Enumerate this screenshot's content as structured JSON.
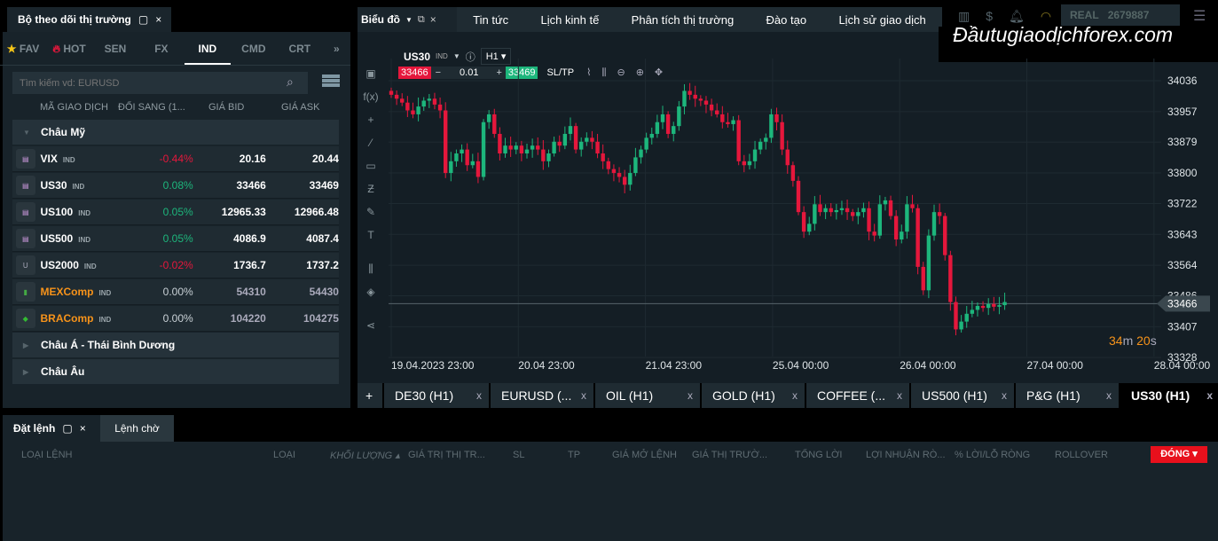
{
  "watchlist": {
    "title": "Bộ theo dõi thị trường",
    "tabs": [
      "FAV",
      "HOT",
      "SEN",
      "FX",
      "IND",
      "CMD",
      "CRT"
    ],
    "active_tab": "IND",
    "search_placeholder": "Tìm kiếm vd: EURUSD",
    "columns": [
      "MÃ GIAO DỊCH",
      "ĐỔI SANG (1...",
      "GIÁ BID",
      "GIÁ ASK"
    ],
    "groups": [
      "Châu Mỹ",
      "Châu Á - Thái Bình Dương",
      "Châu Âu"
    ],
    "rows": [
      {
        "symbol": "VIX",
        "type": "IND",
        "change": "-0.44%",
        "bid": "20.16",
        "ask": "20.44",
        "dir": "down",
        "flag": "us"
      },
      {
        "symbol": "US30",
        "type": "IND",
        "change": "0.08%",
        "bid": "33466",
        "ask": "33469",
        "dir": "up",
        "flag": "us"
      },
      {
        "symbol": "US100",
        "type": "IND",
        "change": "0.05%",
        "bid": "12965.33",
        "ask": "12966.48",
        "dir": "up",
        "flag": "us"
      },
      {
        "symbol": "US500",
        "type": "IND",
        "change": "0.05%",
        "bid": "4086.9",
        "ask": "4087.4",
        "dir": "up",
        "flag": "us"
      },
      {
        "symbol": "US2000",
        "type": "IND",
        "change": "-0.02%",
        "bid": "1736.7",
        "ask": "1737.2",
        "dir": "down",
        "flag": "u"
      },
      {
        "symbol": "MEXComp",
        "type": "IND",
        "change": "0.00%",
        "bid": "54310",
        "ask": "54430",
        "dir": "flat",
        "flag": "mx"
      },
      {
        "symbol": "BRAComp",
        "type": "IND",
        "change": "0.00%",
        "bid": "104220",
        "ask": "104275",
        "dir": "flat",
        "flag": "br"
      }
    ]
  },
  "chart_panel": {
    "title": "Biểu đồ",
    "menu": [
      "Tin tức",
      "Lịch kinh tế",
      "Phân tích thị trường",
      "Đào tạo",
      "Lịch sử giao dịch"
    ],
    "symbol": "US30",
    "symbol_type": "IND",
    "timeframe": "H1",
    "sell": "33466",
    "volume": "0.01",
    "buy": "33469",
    "sltp": "SL/TP",
    "countdown_min": "34",
    "countdown_min_unit": "m",
    "countdown_sec": "20",
    "countdown_sec_unit": "s",
    "tabs": [
      "DE30 (H1)",
      "EURUSD (...",
      "OIL (H1)",
      "GOLD (H1)",
      "COFFEE (...",
      "US500 (H1)",
      "P&G (H1)",
      "US30 (H1)"
    ],
    "active_tab": "US30 (H1)"
  },
  "account": {
    "mode": "REAL",
    "number": "2679887"
  },
  "watermark": "Đầutugiaodịchforex.com",
  "colors": {
    "up": "#1db67c",
    "down": "#e5173c",
    "accent_orange": "#f7931a"
  },
  "chart_data": {
    "type": "candlestick",
    "price_ticks": [
      "34036",
      "33957",
      "33879",
      "33800",
      "33722",
      "33643",
      "33564",
      "33486",
      "33407",
      "33328"
    ],
    "time_ticks": [
      "19.04.2023 23:00",
      "20.04 23:00",
      "21.04 23:00",
      "25.04 00:00",
      "26.04 00:00",
      "27.04 00:00",
      "28.04 00:00"
    ],
    "current_price": "33466",
    "closes": [
      34000,
      33990,
      33980,
      33960,
      33950,
      33970,
      33985,
      33990,
      33975,
      33960,
      33800,
      33830,
      33850,
      33860,
      33820,
      33830,
      33790,
      33930,
      33950,
      33900,
      33850,
      33870,
      33860,
      33870,
      33850,
      33860,
      33870,
      33860,
      33830,
      33850,
      33880,
      33870,
      33900,
      33920,
      33860,
      33880,
      33890,
      33880,
      33850,
      33830,
      33810,
      33800,
      33790,
      33770,
      33800,
      33840,
      33860,
      33890,
      33900,
      33930,
      33950,
      33900,
      33920,
      33970,
      34010,
      34000,
      33990,
      33985,
      33975,
      33960,
      33950,
      33930,
      33925,
      33935,
      33830,
      33820,
      33830,
      33860,
      33880,
      33890,
      33950,
      33930,
      33860,
      33820,
      33780,
      33700,
      33650,
      33670,
      33720,
      33700,
      33710,
      33700,
      33705,
      33710,
      33700,
      33690,
      33700,
      33710,
      33650,
      33640,
      33720,
      33730,
      33690,
      33630,
      33650,
      33720,
      33710,
      33560,
      33500,
      33640,
      33700,
      33690,
      33590,
      33470,
      33400,
      33420,
      33440,
      33450,
      33460,
      33455,
      33465,
      33458,
      33462,
      33470
    ]
  },
  "orders": {
    "tabs": [
      "Đặt lệnh",
      "Lệnh chờ"
    ],
    "columns": [
      "LOẠI LỆNH",
      "LOẠI",
      "KHỐI LƯỢNG ▴",
      "GIÁ TRỊ THỊ TR...",
      "SL",
      "TP",
      "GIÁ MỞ LỆNH",
      "GIÁ THỊ TRƯỜ...",
      "TỔNG LỜI",
      "LỢI NHUẬN RÒ...",
      "% LỜI/LỖ RÒNG",
      "ROLLOVER"
    ],
    "close_button": "ĐÓNG"
  }
}
